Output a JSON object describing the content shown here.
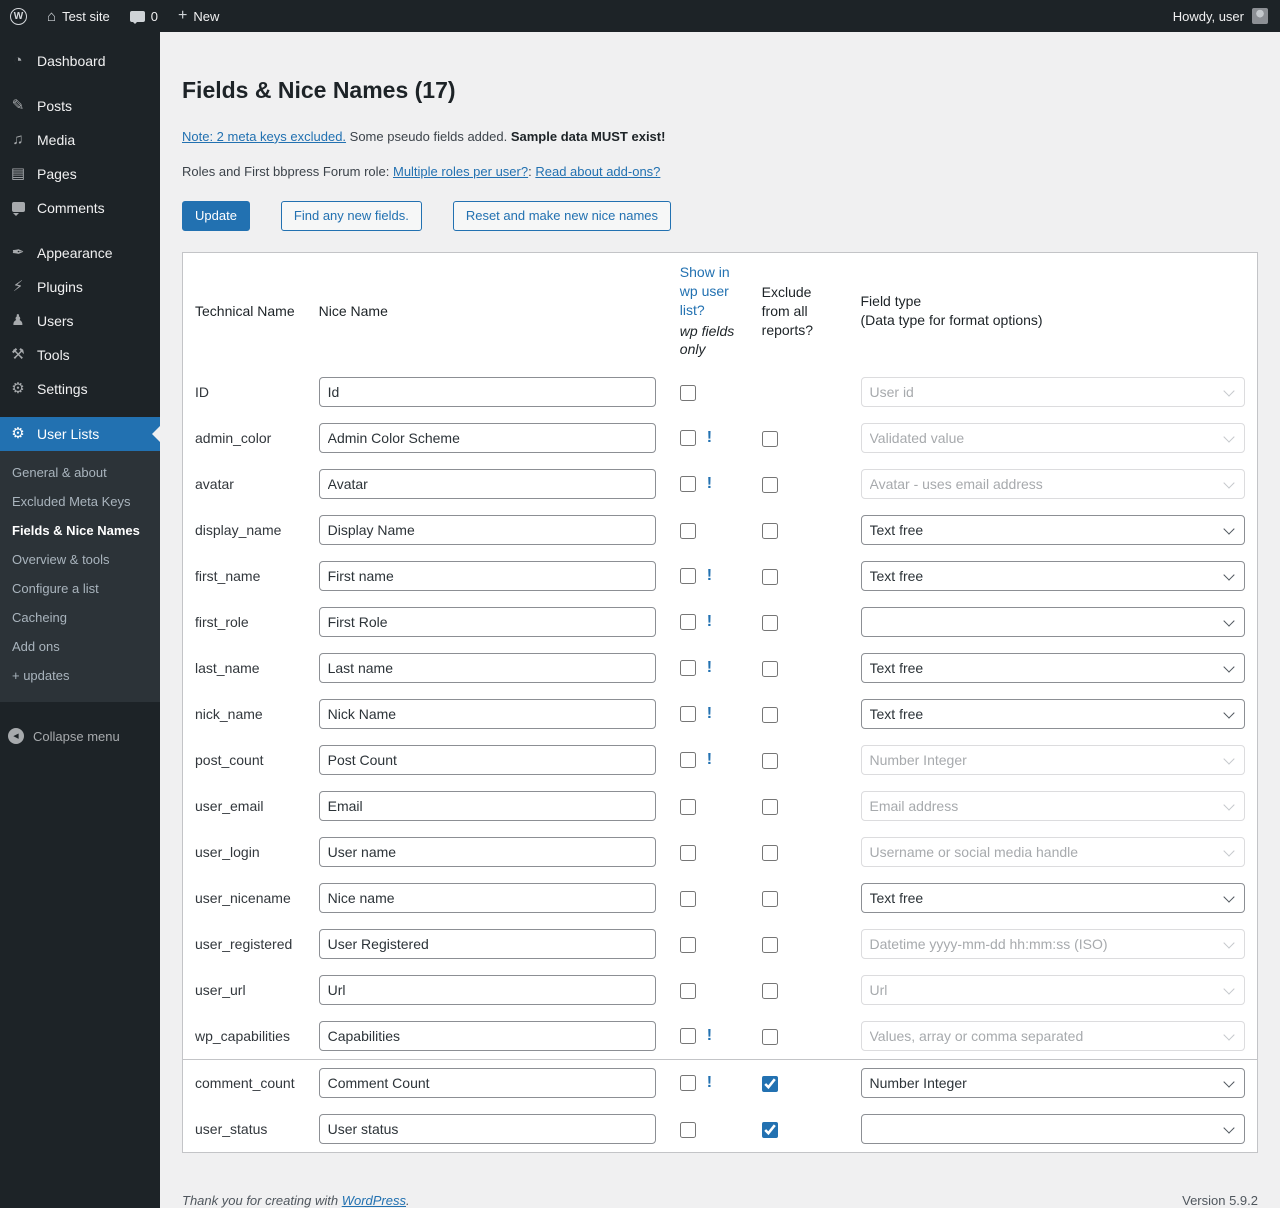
{
  "colors": {
    "accent": "#2271b1",
    "admin_bar_bg": "#1d2327",
    "sidebar_bg": "#1d2327",
    "submenu_bg": "#2c3338",
    "content_bg": "#f0f0f1",
    "table_border": "#c3c4c7",
    "disabled_text": "#a7aaad"
  },
  "icons": {
    "wp_logo_glyph": "W",
    "home_glyph": "⌂",
    "plus_glyph": "+",
    "collapse_glyph": "◀"
  },
  "admin_bar": {
    "site_name": "Test site",
    "comments_count": "0",
    "new_label": "New",
    "howdy": "Howdy, user"
  },
  "sidebar": {
    "items": [
      {
        "name": "sidebar-item-dashboard",
        "icon": "dashboard-icon",
        "glyph": "◔",
        "label": "Dashboard",
        "active": false,
        "sep": true
      },
      {
        "name": "sidebar-item-posts",
        "icon": "posts-icon",
        "glyph": "✎",
        "label": "Posts",
        "active": false,
        "sep": false
      },
      {
        "name": "sidebar-item-media",
        "icon": "media-icon",
        "glyph": "♫",
        "label": "Media",
        "active": false,
        "sep": false
      },
      {
        "name": "sidebar-item-pages",
        "icon": "pages-icon",
        "glyph": "▤",
        "label": "Pages",
        "active": false,
        "sep": false
      },
      {
        "name": "sidebar-item-comments",
        "icon": "comments-icon",
        "glyph": "",
        "label": "Comments",
        "active": false,
        "sep": true
      },
      {
        "name": "sidebar-item-appearance",
        "icon": "appearance-icon",
        "glyph": "✒",
        "label": "Appearance",
        "active": false,
        "sep": false
      },
      {
        "name": "sidebar-item-plugins",
        "icon": "plugins-icon",
        "glyph": "⚡",
        "label": "Plugins",
        "active": false,
        "sep": false
      },
      {
        "name": "sidebar-item-users",
        "icon": "users-icon",
        "glyph": "♟",
        "label": "Users",
        "active": false,
        "sep": false
      },
      {
        "name": "sidebar-item-tools",
        "icon": "tools-icon",
        "glyph": "⚒",
        "label": "Tools",
        "active": false,
        "sep": false
      },
      {
        "name": "sidebar-item-settings",
        "icon": "settings-icon",
        "glyph": "⚙",
        "label": "Settings",
        "active": false,
        "sep": true
      },
      {
        "name": "sidebar-item-user-lists",
        "icon": "gear-icon",
        "glyph": "⚙",
        "label": "User Lists",
        "active": true,
        "sep": false
      }
    ],
    "submenu": [
      {
        "name": "submenu-item-general-about",
        "label": "General & about",
        "current": false
      },
      {
        "name": "submenu-item-excluded-meta-keys",
        "label": "Excluded Meta Keys",
        "current": false
      },
      {
        "name": "submenu-item-fields-nice-names",
        "label": "Fields & Nice Names",
        "current": true
      },
      {
        "name": "submenu-item-overview-tools",
        "label": "Overview & tools",
        "current": false
      },
      {
        "name": "submenu-item-configure-a-list",
        "label": "Configure a list",
        "current": false
      },
      {
        "name": "submenu-item-cacheing",
        "label": "Cacheing",
        "current": false
      },
      {
        "name": "submenu-item-add-ons",
        "label": "Add ons",
        "current": false
      },
      {
        "name": "submenu-item-updates",
        "label": "+ updates",
        "current": false
      }
    ],
    "collapse_label": "Collapse menu"
  },
  "main": {
    "title": "Fields & Nice Names (17)",
    "note": {
      "link": "Note: 2 meta keys excluded.",
      "text": "Some pseudo fields added.",
      "bold": "Sample data MUST exist!"
    },
    "roles": {
      "prefix": "Roles and First bbpress Forum role:",
      "link1": "Multiple roles per user?",
      "colon": ":",
      "link2": "Read about add-ons?"
    },
    "buttons": {
      "update": "Update",
      "find": "Find any new fields.",
      "reset": "Reset and make new nice names"
    },
    "table": {
      "warning_glyph": "!",
      "headers": {
        "technical": "Technical Name",
        "nice": "Nice Name",
        "show_link": "Show in wp user list?",
        "show_note": "wp fields only",
        "exclude": "Exclude from all reports?",
        "field_type": "Field type",
        "field_type_sub": "(Data type for format options)"
      },
      "rows": [
        {
          "technical": "ID",
          "nice": "Id",
          "show_checked": false,
          "warning": false,
          "has_exclude": false,
          "exclude_checked": false,
          "field_type": "User id",
          "type_disabled": true,
          "separator": false
        },
        {
          "technical": "admin_color",
          "nice": "Admin Color Scheme",
          "show_checked": false,
          "warning": true,
          "has_exclude": true,
          "exclude_checked": false,
          "field_type": "Validated value",
          "type_disabled": true,
          "separator": false
        },
        {
          "technical": "avatar",
          "nice": "Avatar",
          "show_checked": false,
          "warning": true,
          "has_exclude": true,
          "exclude_checked": false,
          "field_type": "Avatar - uses email address",
          "type_disabled": true,
          "separator": false
        },
        {
          "technical": "display_name",
          "nice": "Display Name",
          "show_checked": false,
          "warning": false,
          "has_exclude": true,
          "exclude_checked": false,
          "field_type": "Text free",
          "type_disabled": false,
          "separator": false
        },
        {
          "technical": "first_name",
          "nice": "First name",
          "show_checked": false,
          "warning": true,
          "has_exclude": true,
          "exclude_checked": false,
          "field_type": "Text free",
          "type_disabled": false,
          "separator": false
        },
        {
          "technical": "first_role",
          "nice": "First Role",
          "show_checked": false,
          "warning": true,
          "has_exclude": true,
          "exclude_checked": false,
          "field_type": "",
          "type_disabled": false,
          "separator": false
        },
        {
          "technical": "last_name",
          "nice": "Last name",
          "show_checked": false,
          "warning": true,
          "has_exclude": true,
          "exclude_checked": false,
          "field_type": "Text free",
          "type_disabled": false,
          "separator": false
        },
        {
          "technical": "nick_name",
          "nice": "Nick Name",
          "show_checked": false,
          "warning": true,
          "has_exclude": true,
          "exclude_checked": false,
          "field_type": "Text free",
          "type_disabled": false,
          "separator": false
        },
        {
          "technical": "post_count",
          "nice": "Post Count",
          "show_checked": false,
          "warning": true,
          "has_exclude": true,
          "exclude_checked": false,
          "field_type": "Number Integer",
          "type_disabled": true,
          "separator": false
        },
        {
          "technical": "user_email",
          "nice": "Email",
          "show_checked": false,
          "warning": false,
          "has_exclude": true,
          "exclude_checked": false,
          "field_type": "Email address",
          "type_disabled": true,
          "separator": false
        },
        {
          "technical": "user_login",
          "nice": "User name",
          "show_checked": false,
          "warning": false,
          "has_exclude": true,
          "exclude_checked": false,
          "field_type": "Username or social media handle",
          "type_disabled": true,
          "separator": false
        },
        {
          "technical": "user_nicename",
          "nice": "Nice name",
          "show_checked": false,
          "warning": false,
          "has_exclude": true,
          "exclude_checked": false,
          "field_type": "Text free",
          "type_disabled": false,
          "separator": false
        },
        {
          "technical": "user_registered",
          "nice": "User Registered",
          "show_checked": false,
          "warning": false,
          "has_exclude": true,
          "exclude_checked": false,
          "field_type": "Datetime yyyy-mm-dd hh:mm:ss (ISO)",
          "type_disabled": true,
          "separator": false
        },
        {
          "technical": "user_url",
          "nice": "Url",
          "show_checked": false,
          "warning": false,
          "has_exclude": true,
          "exclude_checked": false,
          "field_type": "Url",
          "type_disabled": true,
          "separator": false
        },
        {
          "technical": "wp_capabilities",
          "nice": "Capabilities",
          "show_checked": false,
          "warning": true,
          "has_exclude": true,
          "exclude_checked": false,
          "field_type": "Values, array or comma separated",
          "type_disabled": true,
          "separator": false
        },
        {
          "technical": "comment_count",
          "nice": "Comment Count",
          "show_checked": false,
          "warning": true,
          "has_exclude": true,
          "exclude_checked": true,
          "field_type": "Number Integer",
          "type_disabled": false,
          "separator": true
        },
        {
          "technical": "user_status",
          "nice": "User status",
          "show_checked": false,
          "warning": false,
          "has_exclude": true,
          "exclude_checked": true,
          "field_type": "",
          "type_disabled": false,
          "separator": false
        }
      ]
    }
  },
  "footer": {
    "thanks_prefix": "Thank you for creating with",
    "link": "WordPress",
    "thanks_suffix": ".",
    "version": "Version 5.9.2"
  }
}
